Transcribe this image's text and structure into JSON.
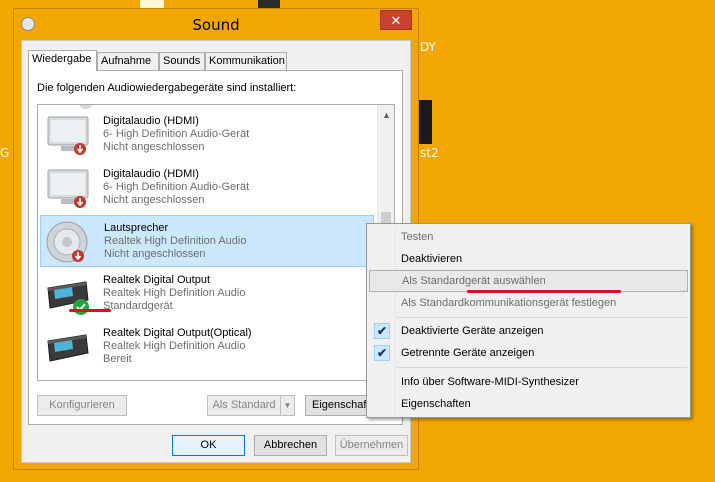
{
  "window": {
    "title": "Sound",
    "close_glyph": "✕"
  },
  "desktop": {
    "label_dy": "DY",
    "label_st2": "st2",
    "label_g": "G"
  },
  "tabs": [
    {
      "label": "Wiedergabe",
      "active": true
    },
    {
      "label": "Aufnahme"
    },
    {
      "label": "Sounds"
    },
    {
      "label": "Kommunikation"
    }
  ],
  "panel": {
    "caption": "Die folgenden Audiowiedergabegeräte sind installiert:"
  },
  "devices": [
    {
      "name": "Digitalaudio (HDMI)",
      "desc": "6- High Definition Audio-Gerät",
      "status": "Nicht angeschlossen",
      "icon": "monitor-icon"
    },
    {
      "name": "Digitalaudio (HDMI)",
      "desc": "6- High Definition Audio-Gerät",
      "status": "Nicht angeschlossen",
      "icon": "monitor-icon"
    },
    {
      "name": "Lautsprecher",
      "desc": "Realtek High Definition Audio",
      "status": "Nicht angeschlossen",
      "icon": "speaker-icon",
      "selected": true
    },
    {
      "name": "Realtek Digital Output",
      "desc": "Realtek High Definition Audio",
      "status": "Standardgerät",
      "icon": "digital-receiver-icon"
    },
    {
      "name": "Realtek Digital Output(Optical)",
      "desc": "Realtek High Definition Audio",
      "status": "Bereit",
      "icon": "digital-receiver-icon"
    }
  ],
  "buttons": {
    "configure": "Konfigurieren",
    "set_default": "Als Standard",
    "properties": "Eigenschaften",
    "ok": "OK",
    "cancel": "Abbrechen",
    "apply": "Übernehmen"
  },
  "context_menu": {
    "items": [
      {
        "label": "Testen",
        "disabled": true
      },
      {
        "label": "Deaktivieren"
      },
      {
        "label": "Als Standardgerät auswählen",
        "disabled": true,
        "highlighted": true
      },
      {
        "label": "Als Standardkommunikationsgerät festlegen",
        "disabled": true
      },
      {
        "label": "Deaktivierte Geräte anzeigen",
        "checked": true
      },
      {
        "label": "Getrennte Geräte anzeigen",
        "checked": true
      },
      {
        "label": "Info über Software-MIDI-Synthesizer"
      },
      {
        "label": "Eigenschaften"
      }
    ],
    "check_glyph": "✔"
  },
  "colors": {
    "desktop": "#f2a600",
    "selection": "#cce8ff",
    "annotation_red": "#d0161f",
    "close_button": "#c7432f"
  }
}
